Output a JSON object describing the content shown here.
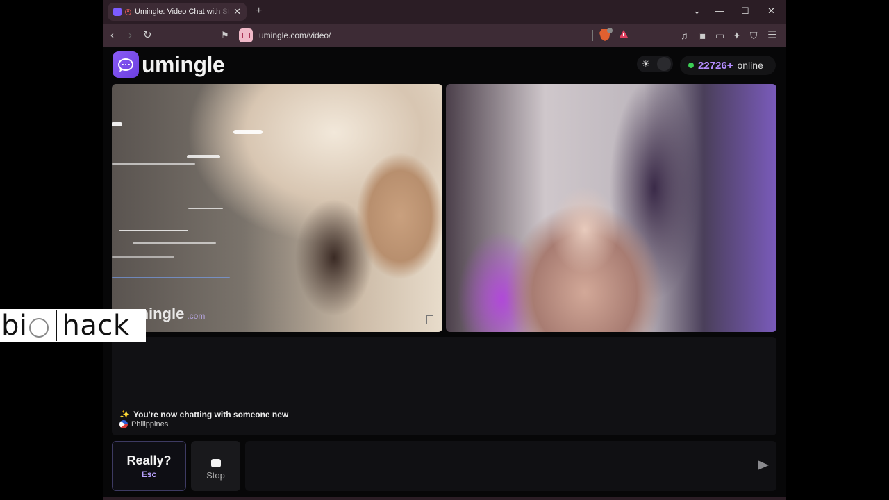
{
  "browser": {
    "tab_title": "Umingle: Video Chat with Strangers",
    "url": "umingle.com/video/",
    "new_tab": "+",
    "close_tab": "✕"
  },
  "site": {
    "logo_text": "umingle",
    "online_count": "22726+",
    "online_label": "online",
    "watermark": "umingle",
    "watermark_suffix": ".com"
  },
  "chat": {
    "system_message": "You're now chatting with someone new",
    "country": "Philippines"
  },
  "controls": {
    "skip_label": "Really?",
    "skip_hint": "Esc",
    "stop_label": "Stop",
    "message_placeholder": ""
  },
  "overlay": {
    "brand_left": "bi",
    "brand_right": "hack"
  },
  "colors": {
    "accent": "#8a5cf6",
    "online_dot": "#3ccf55",
    "online_count": "#b48cff"
  },
  "icons": [
    "back-icon",
    "forward-icon",
    "reload-icon",
    "bookmark-icon",
    "video-site-icon",
    "brave-shield-icon",
    "brave-rewards-icon",
    "music-icon",
    "sidebar-icon",
    "wallet-icon",
    "leo-icon",
    "vpn-icon",
    "menu-icon",
    "sun-icon",
    "flag-icon",
    "send-icon"
  ]
}
